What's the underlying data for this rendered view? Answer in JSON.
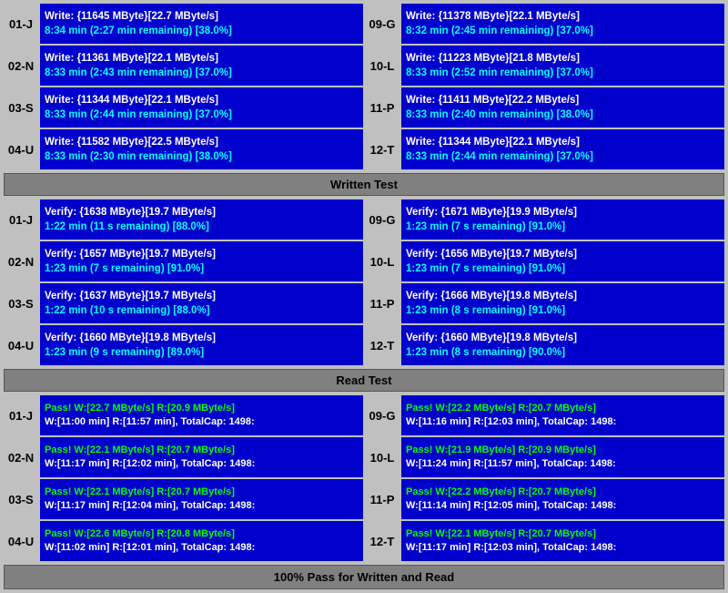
{
  "sections": {
    "write_test": {
      "label": "Written Test",
      "rows": [
        {
          "left_id": "01-J",
          "left_line1": "Write: {11645 MByte}[22.7 MByte/s]",
          "left_line2": "8:34 min (2:27 min remaining)  [38.0%]",
          "right_id": "09-G",
          "right_line1": "Write: {11378 MByte}[22.1 MByte/s]",
          "right_line2": "8:32 min (2:45 min remaining)  [37.0%]"
        },
        {
          "left_id": "02-N",
          "left_line1": "Write: {11361 MByte}[22.1 MByte/s]",
          "left_line2": "8:33 min (2:43 min remaining)  [37.0%]",
          "right_id": "10-L",
          "right_line1": "Write: {11223 MByte}[21.8 MByte/s]",
          "right_line2": "8:33 min (2:52 min remaining)  [37.0%]"
        },
        {
          "left_id": "03-S",
          "left_line1": "Write: {11344 MByte}[22.1 MByte/s]",
          "left_line2": "8:33 min (2:44 min remaining)  [37.0%]",
          "right_id": "11-P",
          "right_line1": "Write: {11411 MByte}[22.2 MByte/s]",
          "right_line2": "8:33 min (2:40 min remaining)  [38.0%]"
        },
        {
          "left_id": "04-U",
          "left_line1": "Write: {11582 MByte}[22.5 MByte/s]",
          "left_line2": "8:33 min (2:30 min remaining)  [38.0%]",
          "right_id": "12-T",
          "right_line1": "Write: {11344 MByte}[22.1 MByte/s]",
          "right_line2": "8:33 min (2:44 min remaining)  [37.0%]"
        }
      ]
    },
    "verify_test": {
      "label": "Written Test",
      "rows": [
        {
          "left_id": "01-J",
          "left_line1": "Verify: {1638 MByte}[19.7 MByte/s]",
          "left_line2": "1:22 min (11 s remaining)  [88.0%]",
          "right_id": "09-G",
          "right_line1": "Verify: {1671 MByte}[19.9 MByte/s]",
          "right_line2": "1:23 min (7 s remaining)  [91.0%]"
        },
        {
          "left_id": "02-N",
          "left_line1": "Verify: {1657 MByte}[19.7 MByte/s]",
          "left_line2": "1:23 min (7 s remaining)  [91.0%]",
          "right_id": "10-L",
          "right_line1": "Verify: {1656 MByte}[19.7 MByte/s]",
          "right_line2": "1:23 min (7 s remaining)  [91.0%]"
        },
        {
          "left_id": "03-S",
          "left_line1": "Verify: {1637 MByte}[19.7 MByte/s]",
          "left_line2": "1:22 min (10 s remaining)  [88.0%]",
          "right_id": "11-P",
          "right_line1": "Verify: {1666 MByte}[19.8 MByte/s]",
          "right_line2": "1:23 min (8 s remaining)  [91.0%]"
        },
        {
          "left_id": "04-U",
          "left_line1": "Verify: {1660 MByte}[19.8 MByte/s]",
          "left_line2": "1:23 min (9 s remaining)  [89.0%]",
          "right_id": "12-T",
          "right_line1": "Verify: {1660 MByte}[19.8 MByte/s]",
          "right_line2": "1:23 min (8 s remaining)  [90.0%]"
        }
      ]
    },
    "read_test": {
      "label": "Read Test",
      "rows": [
        {
          "left_id": "01-J",
          "left_line1": "Pass! W:[22.7 MByte/s] R:[20.9 MByte/s]",
          "left_line2": " W:[11:00 min] R:[11:57 min], TotalCap: 1498:",
          "right_id": "09-G",
          "right_line1": "Pass! W:[22.2 MByte/s] R:[20.7 MByte/s]",
          "right_line2": " W:[11:16 min] R:[12:03 min], TotalCap: 1498:"
        },
        {
          "left_id": "02-N",
          "left_line1": "Pass! W:[22.1 MByte/s] R:[20.7 MByte/s]",
          "left_line2": " W:[11:17 min] R:[12:02 min], TotalCap: 1498:",
          "right_id": "10-L",
          "right_line1": "Pass! W:[21.9 MByte/s] R:[20.9 MByte/s]",
          "right_line2": " W:[11:24 min] R:[11:57 min], TotalCap: 1498:"
        },
        {
          "left_id": "03-S",
          "left_line1": "Pass! W:[22.1 MByte/s] R:[20.7 MByte/s]",
          "left_line2": " W:[11:17 min] R:[12:04 min], TotalCap: 1498:",
          "right_id": "11-P",
          "right_line1": "Pass! W:[22.2 MByte/s] R:[20.7 MByte/s]",
          "right_line2": " W:[11:14 min] R:[12:05 min], TotalCap: 1498:"
        },
        {
          "left_id": "04-U",
          "left_line1": "Pass! W:[22.6 MByte/s] R:[20.8 MByte/s]",
          "left_line2": " W:[11:02 min] R:[12:01 min], TotalCap: 1498:",
          "right_id": "12-T",
          "right_line1": "Pass! W:[22.1 MByte/s] R:[20.7 MByte/s]",
          "right_line2": " W:[11:17 min] R:[12:03 min], TotalCap: 1498:"
        }
      ]
    }
  },
  "headers": {
    "written_test": "Written Test",
    "read_test": "Read Test"
  },
  "footer": "100% Pass for Written and Read"
}
